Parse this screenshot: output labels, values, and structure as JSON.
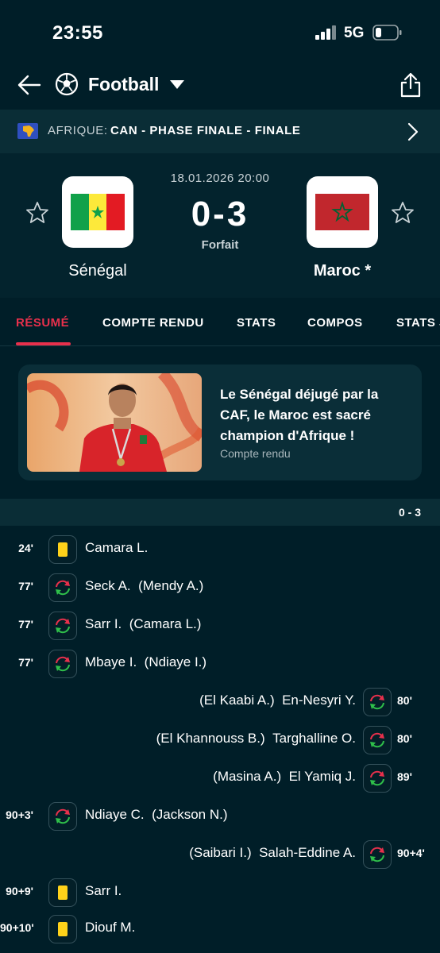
{
  "status_bar": {
    "time": "23:55",
    "network": "5G"
  },
  "header": {
    "sport": "Football",
    "icons": [
      "back-arrow-icon",
      "football-icon",
      "chevron-down-icon",
      "share-icon"
    ]
  },
  "competition": {
    "region": "AFRIQUE:",
    "name": "CAN - PHASE FINALE - FINALE"
  },
  "match": {
    "datetime": "18.01.2026 20:00",
    "score": "0-3",
    "status": "Forfait",
    "home": {
      "name": "Sénégal"
    },
    "away": {
      "name": "Maroc *"
    }
  },
  "tabs": [
    "RÉSUMÉ",
    "COMPTE RENDU",
    "STATS",
    "COMPOS",
    "STATS JO"
  ],
  "article": {
    "title": "Le Sénégal déjugé par la CAF, le Maroc est sacré champion d'Afrique !",
    "category": "Compte rendu"
  },
  "summary_score": "0 - 3",
  "events": [
    {
      "side": "left",
      "minute": "24'",
      "type": "yellow-card",
      "player": "Camara L.",
      "secondary": ""
    },
    {
      "side": "left",
      "minute": "77'",
      "type": "substitution",
      "player": "Seck A.",
      "secondary": "(Mendy A.)"
    },
    {
      "side": "left",
      "minute": "77'",
      "type": "substitution",
      "player": "Sarr I.",
      "secondary": "(Camara L.)"
    },
    {
      "side": "left",
      "minute": "77'",
      "type": "substitution",
      "player": "Mbaye I.",
      "secondary": "(Ndiaye I.)"
    },
    {
      "side": "right",
      "minute": "80'",
      "type": "substitution",
      "player": "En-Nesyri Y.",
      "secondary": "(El Kaabi A.)"
    },
    {
      "side": "right",
      "minute": "80'",
      "type": "substitution",
      "player": "Targhalline O.",
      "secondary": "(El Khannouss B.)"
    },
    {
      "side": "right",
      "minute": "89'",
      "type": "substitution",
      "player": "El Yamiq J.",
      "secondary": "(Masina A.)"
    },
    {
      "side": "left",
      "minute": "90+3'",
      "type": "substitution",
      "player": "Ndiaye C.",
      "secondary": "(Jackson N.)"
    },
    {
      "side": "right",
      "minute": "90+4'",
      "type": "substitution",
      "player": "Salah-Eddine A.",
      "secondary": "(Saibari I.)"
    },
    {
      "side": "left",
      "minute": "90+9'",
      "type": "yellow-card",
      "player": "Sarr I.",
      "secondary": ""
    },
    {
      "side": "left",
      "minute": "90+10'",
      "type": "yellow-card",
      "player": "Diouf M.",
      "secondary": ""
    }
  ],
  "colors": {
    "background": "#001e28",
    "accent": "#e8304c",
    "yellow_card": "#ffd21a",
    "sub_in": "#2fbf4a",
    "sub_out": "#e8304c"
  }
}
